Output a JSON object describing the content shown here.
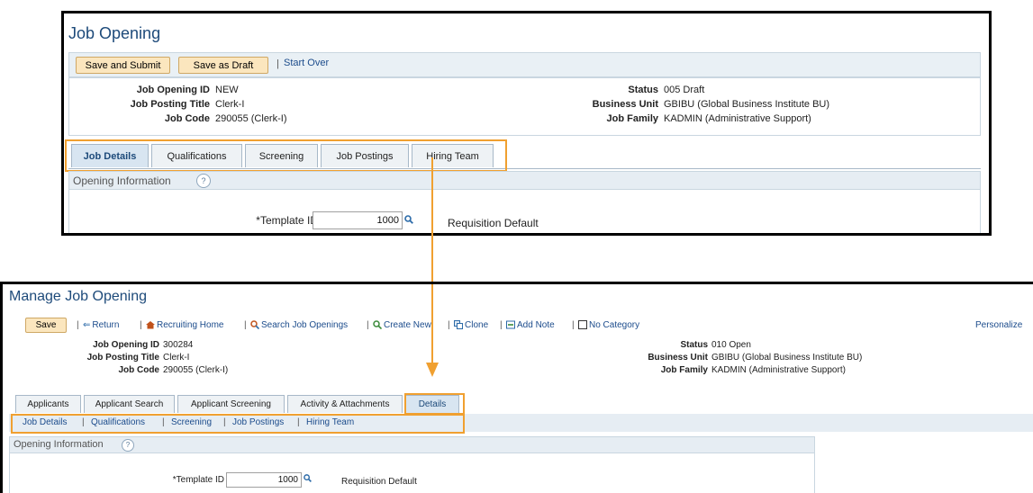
{
  "top": {
    "title": "Job Opening",
    "toolbar": {
      "save_submit": "Save and Submit",
      "save_draft": "Save as Draft",
      "separator": "|",
      "start_over": "Start Over"
    },
    "info": {
      "job_opening_id_label": "Job Opening ID",
      "job_opening_id_value": "NEW",
      "job_posting_title_label": "Job Posting Title",
      "job_posting_title_value": "Clerk-I",
      "job_code_label": "Job Code",
      "job_code_value": "290055 (Clerk-I)",
      "status_label": "Status",
      "status_value": "005 Draft",
      "business_unit_label": "Business Unit",
      "business_unit_value": "GBIBU (Global Business Institute BU)",
      "job_family_label": "Job Family",
      "job_family_value": "KADMIN (Administrative Support)"
    },
    "tabs": [
      "Job Details",
      "Qualifications",
      "Screening",
      "Job Postings",
      "Hiring Team"
    ],
    "section_title": "Opening Information",
    "help": "?",
    "template_label": "*Template ID",
    "template_value": "1000",
    "template_desc": "Requisition Default"
  },
  "bottom": {
    "title": "Manage Job Opening",
    "toolbar": {
      "save": "Save",
      "return": "Return",
      "recruiting_home": "Recruiting Home",
      "search_job_openings": "Search Job Openings",
      "create_new": "Create New",
      "clone": "Clone",
      "add_note": "Add Note",
      "no_category": "No Category",
      "personalize": "Personalize",
      "sep": "|"
    },
    "info": {
      "job_opening_id_label": "Job Opening ID",
      "job_opening_id_value": "300284",
      "job_posting_title_label": "Job Posting Title",
      "job_posting_title_value": "Clerk-I",
      "job_code_label": "Job Code",
      "job_code_value": "290055 (Clerk-I)",
      "status_label": "Status",
      "status_value": "010 Open",
      "business_unit_label": "Business Unit",
      "business_unit_value": "GBIBU (Global Business Institute BU)",
      "job_family_label": "Job Family",
      "job_family_value": "KADMIN (Administrative Support)"
    },
    "tabs": [
      "Applicants",
      "Applicant Search",
      "Applicant Screening",
      "Activity & Attachments",
      "Details"
    ],
    "subnav": [
      "Job Details",
      "Qualifications",
      "Screening",
      "Job Postings",
      "Hiring Team"
    ],
    "subnav_sep": "|",
    "section_title": "Opening Information",
    "help": "?",
    "template_label": "*Template ID",
    "template_value": "1000",
    "template_desc": "Requisition Default"
  },
  "colors": {
    "highlight": "#f0a030",
    "title": "#1d4a7a",
    "link": "#1c4c8c",
    "button": "#fbe6be"
  }
}
